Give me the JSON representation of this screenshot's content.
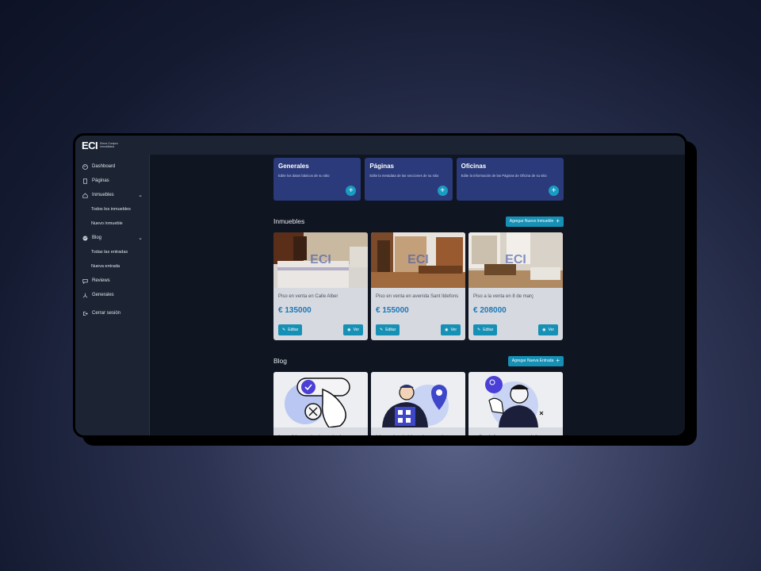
{
  "brand": {
    "logo": "ECI",
    "subtitle": "Elena Compra Inmobiliaria"
  },
  "sidebar": {
    "items": [
      {
        "label": "Dashboard",
        "icon": "palette-icon"
      },
      {
        "label": "Páginas",
        "icon": "page-icon"
      },
      {
        "label": "Inmuebles",
        "icon": "home-icon"
      },
      {
        "label": "Todos los inmuebles"
      },
      {
        "label": "Nuevo inmueble"
      },
      {
        "label": "Blog",
        "icon": "globe-icon"
      },
      {
        "label": "Todas las entradas"
      },
      {
        "label": "Nueva entrada"
      },
      {
        "label": "Reviews",
        "icon": "chat-icon"
      },
      {
        "label": "Generales",
        "icon": "sliders-icon"
      },
      {
        "label": "Cerrar sesión",
        "icon": "logout-icon"
      }
    ]
  },
  "top_cards": [
    {
      "title": "Generales",
      "desc": "Edite los datos básicos de su sitio"
    },
    {
      "title": "Páginas",
      "desc": "Edite la metadata de las secciones de su sitio"
    },
    {
      "title": "Oficinas",
      "desc": "Edite la información de las Páginas de Oficina de su sitio"
    }
  ],
  "inmuebles": {
    "title": "Inmuebles",
    "add_label": "Agregar Nuevo Inmueble",
    "items": [
      {
        "title": "Piso en venta en Calle Alber",
        "price": "€ 135000"
      },
      {
        "title": "Piso en venta en avenida Sant Ildefons",
        "price": "€ 155000"
      },
      {
        "title": "Piso a la venta en 8 de març",
        "price": "€ 208000"
      }
    ],
    "edit_label": "Editar",
    "view_label": "Ver",
    "watermark": "ECI"
  },
  "blog": {
    "title": "Blog",
    "add_label": "Agregar Nueva Entrada",
    "items": [
      {
        "title": "Las Novedades de la"
      },
      {
        "title": "Una decisión clave al"
      },
      {
        "title": "¿Qué factores podrían"
      }
    ]
  },
  "colors": {
    "accent": "#1690b5",
    "card_blue": "#2a3a7a",
    "sidebar": "#1c2433",
    "price": "#1d78b8"
  }
}
